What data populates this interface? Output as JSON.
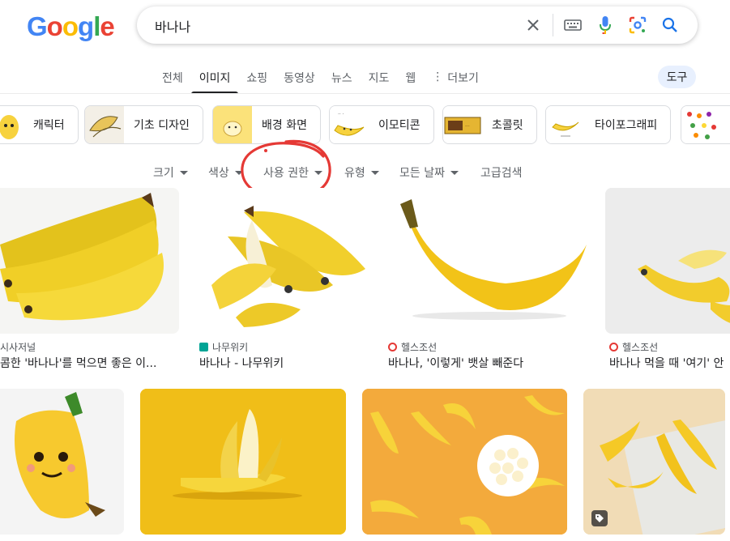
{
  "header": {
    "logo_letters": [
      {
        "ch": "G",
        "color": "#4285F4"
      },
      {
        "ch": "o",
        "color": "#EA4335"
      },
      {
        "ch": "o",
        "color": "#FBBC05"
      },
      {
        "ch": "g",
        "color": "#4285F4"
      },
      {
        "ch": "l",
        "color": "#34A853"
      },
      {
        "ch": "e",
        "color": "#EA4335"
      }
    ],
    "search_query": "바나나",
    "icons": [
      "clear-icon",
      "keyboard-icon",
      "microphone-icon",
      "lens-icon",
      "search-icon"
    ]
  },
  "nav": {
    "tabs": [
      "전체",
      "이미지",
      "쇼핑",
      "동영상",
      "뉴스",
      "지도",
      "웹",
      "더보기"
    ],
    "active_tab": "이미지",
    "tools_label": "도구"
  },
  "chips": [
    "캐릭터",
    "기초 디자인",
    "배경 화면",
    "이모티콘",
    "초콜릿",
    "타이포그래피"
  ],
  "filters": {
    "size": "크기",
    "color": "색상",
    "usage_rights": "사용 권한",
    "type": "유형",
    "date": "모든 날짜",
    "advanced": "고급검색"
  },
  "annotation": {
    "color": "#e53935",
    "shape": "hand-drawn-circle"
  },
  "results_row1": [
    {
      "source": "시사저널",
      "title": "콤한 '바나나'를 먹으면 좋은 이..."
    },
    {
      "source": "나무위키",
      "title": "바나나 - 나무위키"
    },
    {
      "source": "헬스조선",
      "title": "바나나, '이렇게' 뱃살 빼준다"
    },
    {
      "source": "헬스조선",
      "title": "바나나 먹을 때 '여기' 안"
    }
  ],
  "colors": {
    "accent_blue": "#1a73e8",
    "tools_bg": "#e8f0fe",
    "banana_yellow": "#f5c518"
  }
}
